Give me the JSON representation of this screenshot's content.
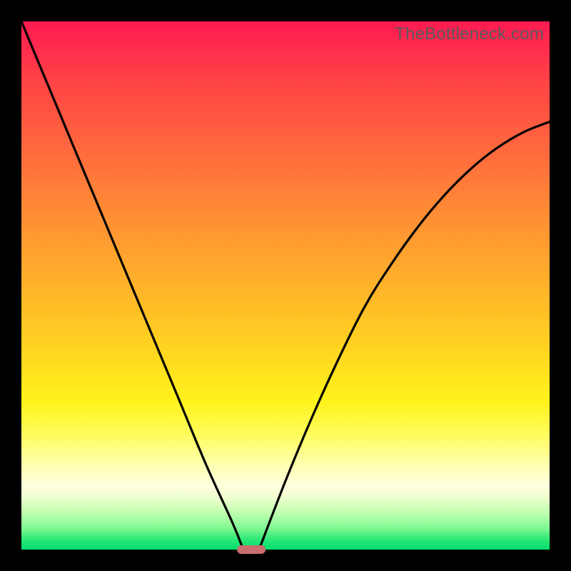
{
  "watermark": "TheBottleneck.com",
  "chart_data": {
    "type": "line",
    "title": "",
    "xlabel": "",
    "ylabel": "",
    "xlim": [
      0,
      100
    ],
    "ylim": [
      0,
      100
    ],
    "grid": false,
    "legend": false,
    "background_gradient": {
      "direction": "top-to-bottom",
      "stops": [
        {
          "pos": 0,
          "color": "#ff1a52"
        },
        {
          "pos": 25,
          "color": "#ff6b3d"
        },
        {
          "pos": 50,
          "color": "#ffb22a"
        },
        {
          "pos": 72,
          "color": "#fff31c"
        },
        {
          "pos": 88,
          "color": "#ffffe0"
        },
        {
          "pos": 100,
          "color": "#00df6e"
        }
      ]
    },
    "series": [
      {
        "name": "left-curve",
        "x": [
          0,
          5,
          10,
          15,
          20,
          25,
          30,
          35,
          40,
          42
        ],
        "y": [
          100,
          88,
          76,
          64,
          52,
          40,
          28,
          16,
          5,
          0
        ]
      },
      {
        "name": "right-curve",
        "x": [
          45,
          50,
          55,
          60,
          65,
          70,
          75,
          80,
          85,
          90,
          95,
          100
        ],
        "y": [
          0,
          13,
          25,
          36,
          46,
          54,
          61,
          67,
          72,
          76,
          79,
          81
        ]
      }
    ],
    "marker": {
      "name": "bottom-marker",
      "x": 43.5,
      "y": 0,
      "shape": "rounded-rect",
      "color": "#cb6e6f"
    }
  }
}
